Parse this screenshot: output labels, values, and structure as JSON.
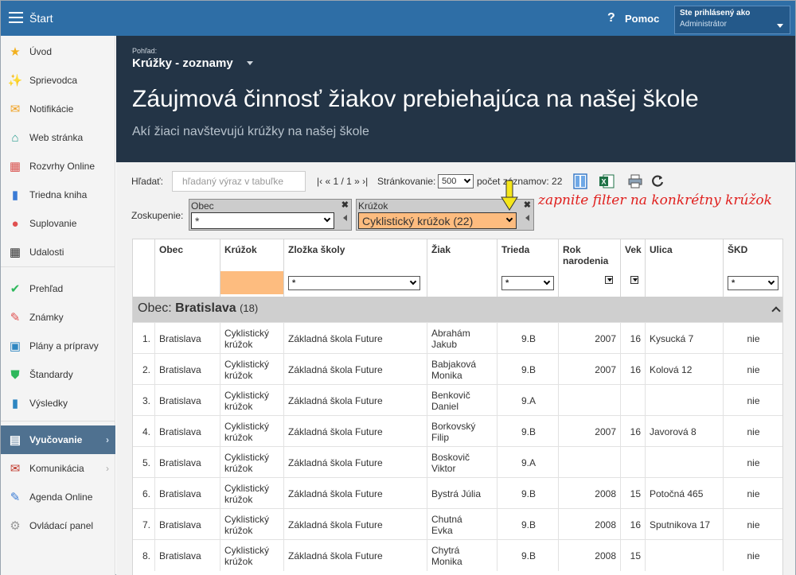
{
  "topbar": {
    "start": "Štart",
    "help_q": "?",
    "help": "Pomoc",
    "user_line1": "Ste prihlásený ako",
    "user_line2": "Administrátor"
  },
  "sidebar": {
    "items": [
      {
        "label": "Úvod",
        "icon": "star-icon"
      },
      {
        "label": "Sprievodca",
        "icon": "wand-icon"
      },
      {
        "label": "Notifikácie",
        "icon": "envelope-icon"
      },
      {
        "label": "Web stránka",
        "icon": "home-icon"
      },
      {
        "label": "Rozvrhy Online",
        "icon": "calendar-grid-icon"
      },
      {
        "label": "Triedna kniha",
        "icon": "book-icon"
      },
      {
        "label": "Suplovanie",
        "icon": "person-icon"
      },
      {
        "label": "Udalosti",
        "icon": "calendar-icon"
      },
      {
        "label": "Prehľad",
        "icon": "check-circle-icon"
      },
      {
        "label": "Známky",
        "icon": "grade-icon"
      },
      {
        "label": "Plány a prípravy",
        "icon": "briefcase-icon"
      },
      {
        "label": "Štandardy",
        "icon": "shield-check-icon"
      },
      {
        "label": "Výsledky",
        "icon": "bar-chart-icon"
      },
      {
        "label": "Vyučovanie",
        "icon": "open-book-icon"
      },
      {
        "label": "Komunikácia",
        "icon": "chat-icon"
      },
      {
        "label": "Agenda Online",
        "icon": "pen-icon"
      },
      {
        "label": "Ovládací panel",
        "icon": "gear-icon"
      }
    ]
  },
  "header": {
    "view_label": "Pohľad:",
    "view_value": "Krúžky - zoznamy",
    "title": "Záujmová činnosť žiakov prebiehajúca na našej škole",
    "subtitle": "Akí žiaci navštevujú krúžky na našej škole"
  },
  "toolbar": {
    "search_label": "Hľadať:",
    "search_placeholder": "hľadaný výraz v tabuľke",
    "pager_text": "|‹ « 1 / 1 » ›|",
    "paging_label": "Stránkovanie:",
    "paging_value": "500",
    "count_text": "počet záznamov: 22",
    "group_label": "Zoskupenie:"
  },
  "filters": {
    "obec_title": "Obec",
    "obec_value": "*",
    "kruzok_title": "Krúžok",
    "kruzok_value": "Cyklistický krúžok (22)",
    "close": "✖"
  },
  "annotation": "zapnite filter na konkrétny krúžok",
  "table": {
    "headers": [
      "",
      "Obec",
      "Krúžok",
      "Zložka školy",
      "Žiak",
      "Trieda",
      "Rok narodenia",
      "Vek",
      "Ulica",
      "ŠKD"
    ],
    "filter_any": "*",
    "group": {
      "prefix": "Obec: ",
      "name": "Bratislava",
      "count": "(18)"
    },
    "rows": [
      [
        "1.",
        "Bratislava",
        "Cyklistický krúžok",
        "Základná škola Future",
        "Abrahám Jakub",
        "9.B",
        "2007",
        "16",
        "Kysucká 7",
        "nie"
      ],
      [
        "2.",
        "Bratislava",
        "Cyklistický krúžok",
        "Základná škola Future",
        "Babjaková Monika",
        "9.B",
        "2007",
        "16",
        "Kolová 12",
        "nie"
      ],
      [
        "3.",
        "Bratislava",
        "Cyklistický krúžok",
        "Základná škola Future",
        "Benkovič Daniel",
        "9.A",
        "",
        "",
        "",
        "nie"
      ],
      [
        "4.",
        "Bratislava",
        "Cyklistický krúžok",
        "Základná škola Future",
        "Borkovský Filip",
        "9.B",
        "2007",
        "16",
        "Javorová 8",
        "nie"
      ],
      [
        "5.",
        "Bratislava",
        "Cyklistický krúžok",
        "Základná škola Future",
        "Boskovič Viktor",
        "9.A",
        "",
        "",
        "",
        "nie"
      ],
      [
        "6.",
        "Bratislava",
        "Cyklistický krúžok",
        "Základná škola Future",
        "Bystrá Júlia",
        "9.B",
        "2008",
        "15",
        "Potočná 465",
        "nie"
      ],
      [
        "7.",
        "Bratislava",
        "Cyklistický krúžok",
        "Základná škola Future",
        "Chutná Evka",
        "9.B",
        "2008",
        "16",
        "Sputnikova 17",
        "nie"
      ],
      [
        "8.",
        "Bratislava",
        "Cyklistický krúžok",
        "Základná škola Future",
        "Chytrá Monika",
        "9.B",
        "2008",
        "15",
        "",
        "nie"
      ]
    ]
  },
  "colors": {
    "topbar": "#2e6ea6",
    "header": "#233446",
    "filter_highlight": "#fdbc7f",
    "annotation": "#e0201e",
    "active_sidebar": "#4f7190"
  }
}
